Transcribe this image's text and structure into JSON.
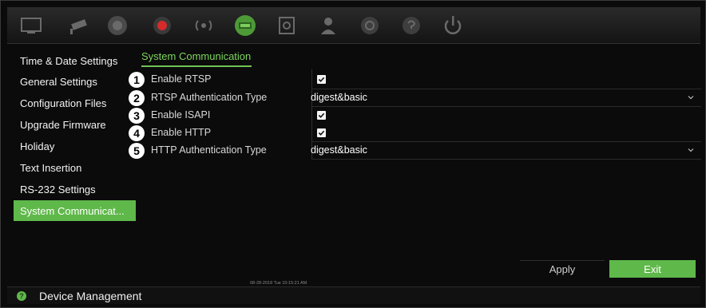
{
  "toolbar": {
    "icons": [
      "monitor-icon",
      "camera-icon",
      "recording-icon",
      "alarm-icon",
      "network-icon",
      "device-management-icon",
      "storage-icon",
      "user-icon",
      "settings-icon",
      "help-icon",
      "power-icon"
    ],
    "active": "device-management-icon"
  },
  "sidebar": {
    "items": [
      {
        "label": "Time & Date Settings"
      },
      {
        "label": "General Settings"
      },
      {
        "label": "Configuration Files"
      },
      {
        "label": "Upgrade Firmware"
      },
      {
        "label": "Holiday"
      },
      {
        "label": "Text Insertion"
      },
      {
        "label": "RS-232 Settings"
      },
      {
        "label": "System Communicat..."
      }
    ],
    "active_index": 7
  },
  "main": {
    "tab_title": "System Communication",
    "rows": [
      {
        "num": "1",
        "label": "Enable RTSP",
        "type": "checkbox",
        "checked": true
      },
      {
        "num": "2",
        "label": "RTSP Authentication Type",
        "type": "dropdown",
        "value": "digest&basic"
      },
      {
        "num": "3",
        "label": "Enable ISAPI",
        "type": "checkbox",
        "checked": true
      },
      {
        "num": "4",
        "label": "Enable HTTP",
        "type": "checkbox",
        "checked": true
      },
      {
        "num": "5",
        "label": "HTTP Authentication Type",
        "type": "dropdown",
        "value": "digest&basic"
      }
    ]
  },
  "buttons": {
    "apply": "Apply",
    "exit": "Exit"
  },
  "timestamp": "08-28-2018 Tue 10:15:21 AM",
  "statusbar": {
    "text": "Device Management"
  },
  "colors": {
    "accent": "#5fb84a",
    "background": "#0b0b0b"
  }
}
